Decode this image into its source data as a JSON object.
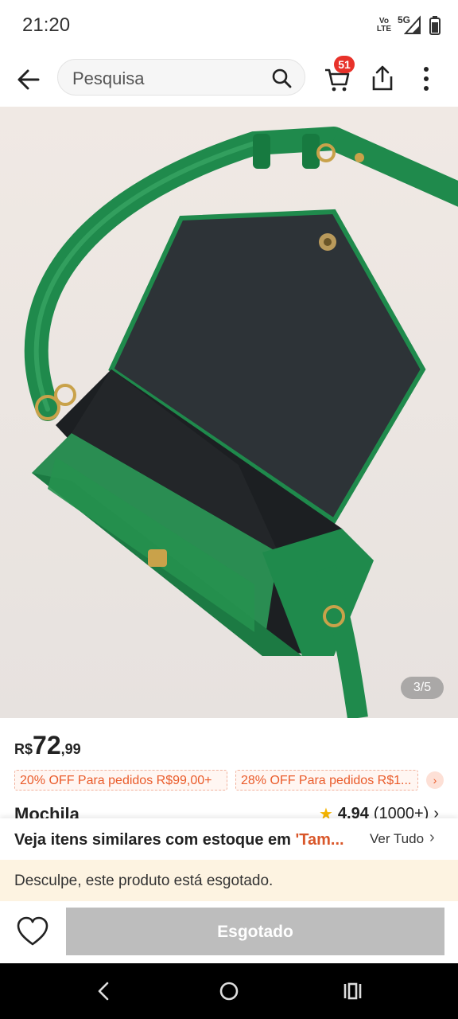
{
  "status_bar": {
    "time": "21:20",
    "volte_top": "Vo",
    "volte_bottom": "LTE",
    "network": "5G"
  },
  "header": {
    "search_placeholder": "Pesquisa",
    "cart_badge": "51"
  },
  "gallery": {
    "counter": "3/5"
  },
  "price": {
    "currency": "R$",
    "integer": "72",
    "cents": ",99"
  },
  "coupons": [
    "20% OFF Para pedidos R$99,00+",
    "28% OFF Para pedidos R$1..."
  ],
  "product": {
    "title": "Mochila",
    "rating": "4,94",
    "reviews": "(1000+)"
  },
  "similar": {
    "text": "Veja itens similares com estoque em ",
    "store": "'Tam...",
    "link": "Ver Tudo"
  },
  "notice": {
    "sold_out": "Desculpe, este produto está esgotado."
  },
  "actions": {
    "button": "Esgotado"
  },
  "colors": {
    "accent": "#ea5b2a",
    "badge": "#e8322a",
    "disabled_button": "#bdbdbd",
    "notice_bg": "#fdf3e1"
  }
}
